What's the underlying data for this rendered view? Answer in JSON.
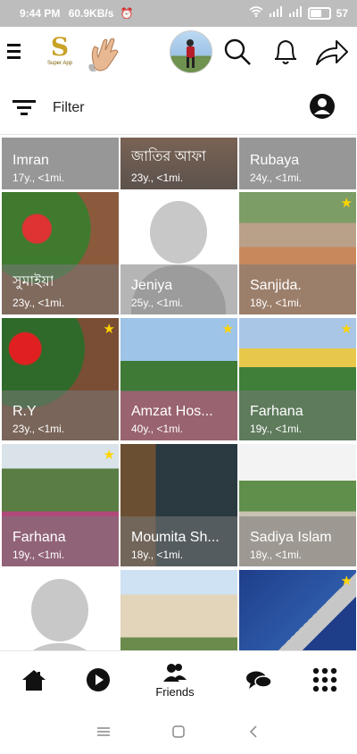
{
  "status_bar": {
    "time": "9:44 PM",
    "speed": "60.9KB/s",
    "battery": "57"
  },
  "header": {
    "logo_text": "Super App"
  },
  "filter": {
    "label": "Filter"
  },
  "profiles": [
    {
      "name": "Imran",
      "meta": "17y., <1mi.",
      "star": false
    },
    {
      "name": "জাতির আফা",
      "meta": "23y., <1mi.",
      "star": false
    },
    {
      "name": "Rubaya",
      "meta": "24y., <1mi.",
      "star": false
    },
    {
      "name": "সুমাইয়া",
      "meta": "23y., <1mi.",
      "star": false
    },
    {
      "name": "Jeniya",
      "meta": "25y., <1mi.",
      "star": false
    },
    {
      "name": "Sanjida.",
      "meta": "18y., <1mi.",
      "star": true
    },
    {
      "name": "R.Y",
      "meta": "23y., <1mi.",
      "star": true
    },
    {
      "name": "Amzat Hos...",
      "meta": "40y., <1mi.",
      "star": true
    },
    {
      "name": "Farhana",
      "meta": "19y., <1mi.",
      "star": true
    },
    {
      "name": "Farhana",
      "meta": "19y., <1mi.",
      "star": true
    },
    {
      "name": "Moumita Sh...",
      "meta": "18y., <1mi.",
      "star": false
    },
    {
      "name": "Sadiya Islam",
      "meta": "18y., <1mi.",
      "star": false
    },
    {
      "name": "",
      "meta": "",
      "star": false
    },
    {
      "name": "",
      "meta": "",
      "star": false
    },
    {
      "name": "",
      "meta": "",
      "star": true
    }
  ],
  "bottom_nav": {
    "friends_label": "Friends"
  },
  "icons": [
    "menu-icon",
    "search-icon",
    "bell-icon",
    "share-icon",
    "filter-icon",
    "user-icon",
    "home-icon",
    "play-icon",
    "friends-icon",
    "chat-icon",
    "apps-icon",
    "star-icon"
  ]
}
